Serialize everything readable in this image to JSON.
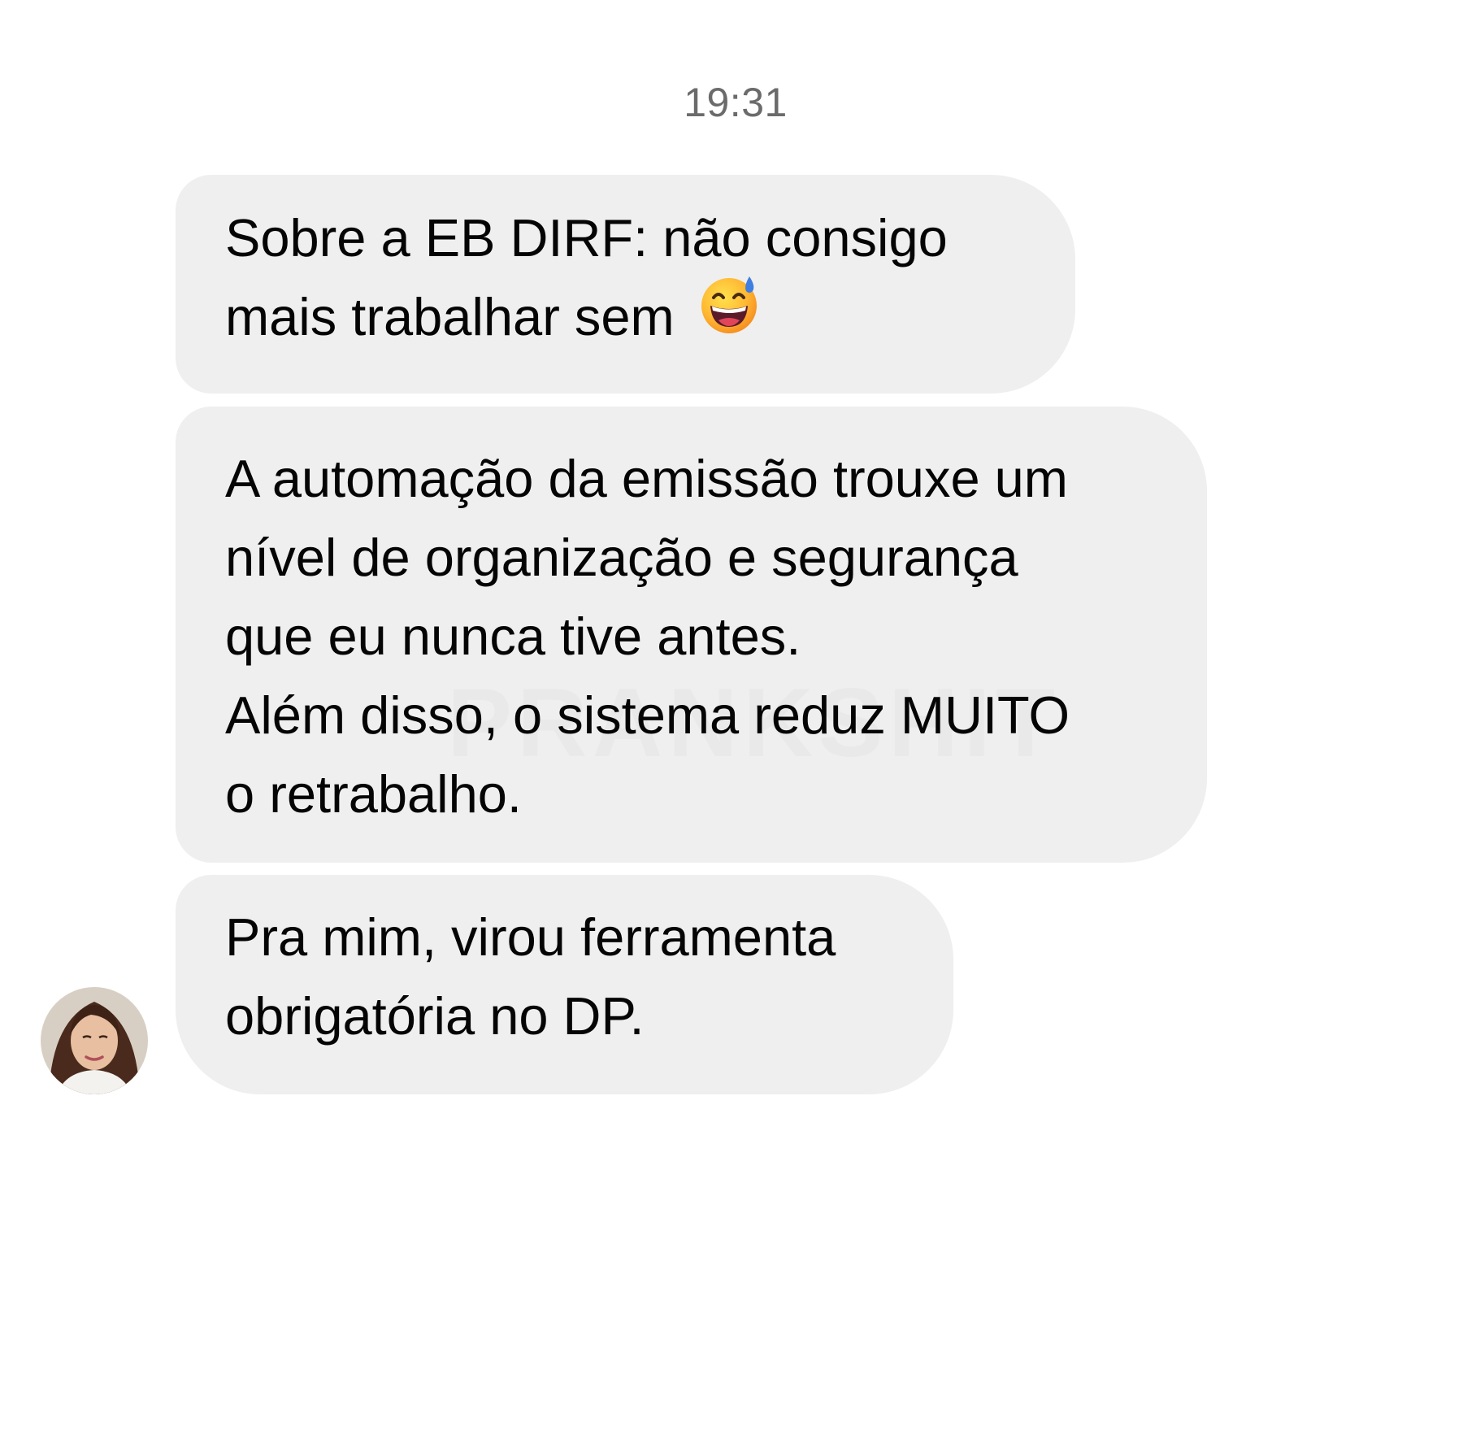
{
  "timestamp": "19:31",
  "messages": [
    {
      "lines": [
        "Sobre a EB DIRF: não consigo",
        "mais trabalhar sem"
      ],
      "emoji": "grinning-face-with-sweat-emoji"
    },
    {
      "lines": [
        "A automação da emissão trouxe um",
        "nível de organização e segurança",
        "que eu nunca tive antes.",
        "Além disso, o sistema reduz MUITO",
        "o retrabalho."
      ]
    },
    {
      "lines": [
        "Pra mim, virou ferramenta",
        "obrigatória no DP."
      ]
    }
  ],
  "watermark": "PRANKSHIT",
  "avatar": "sender-avatar-photo",
  "colors": {
    "bubble": "#efefef",
    "text": "#050505",
    "timestamp": "#6b6b6b",
    "background": "#ffffff"
  }
}
